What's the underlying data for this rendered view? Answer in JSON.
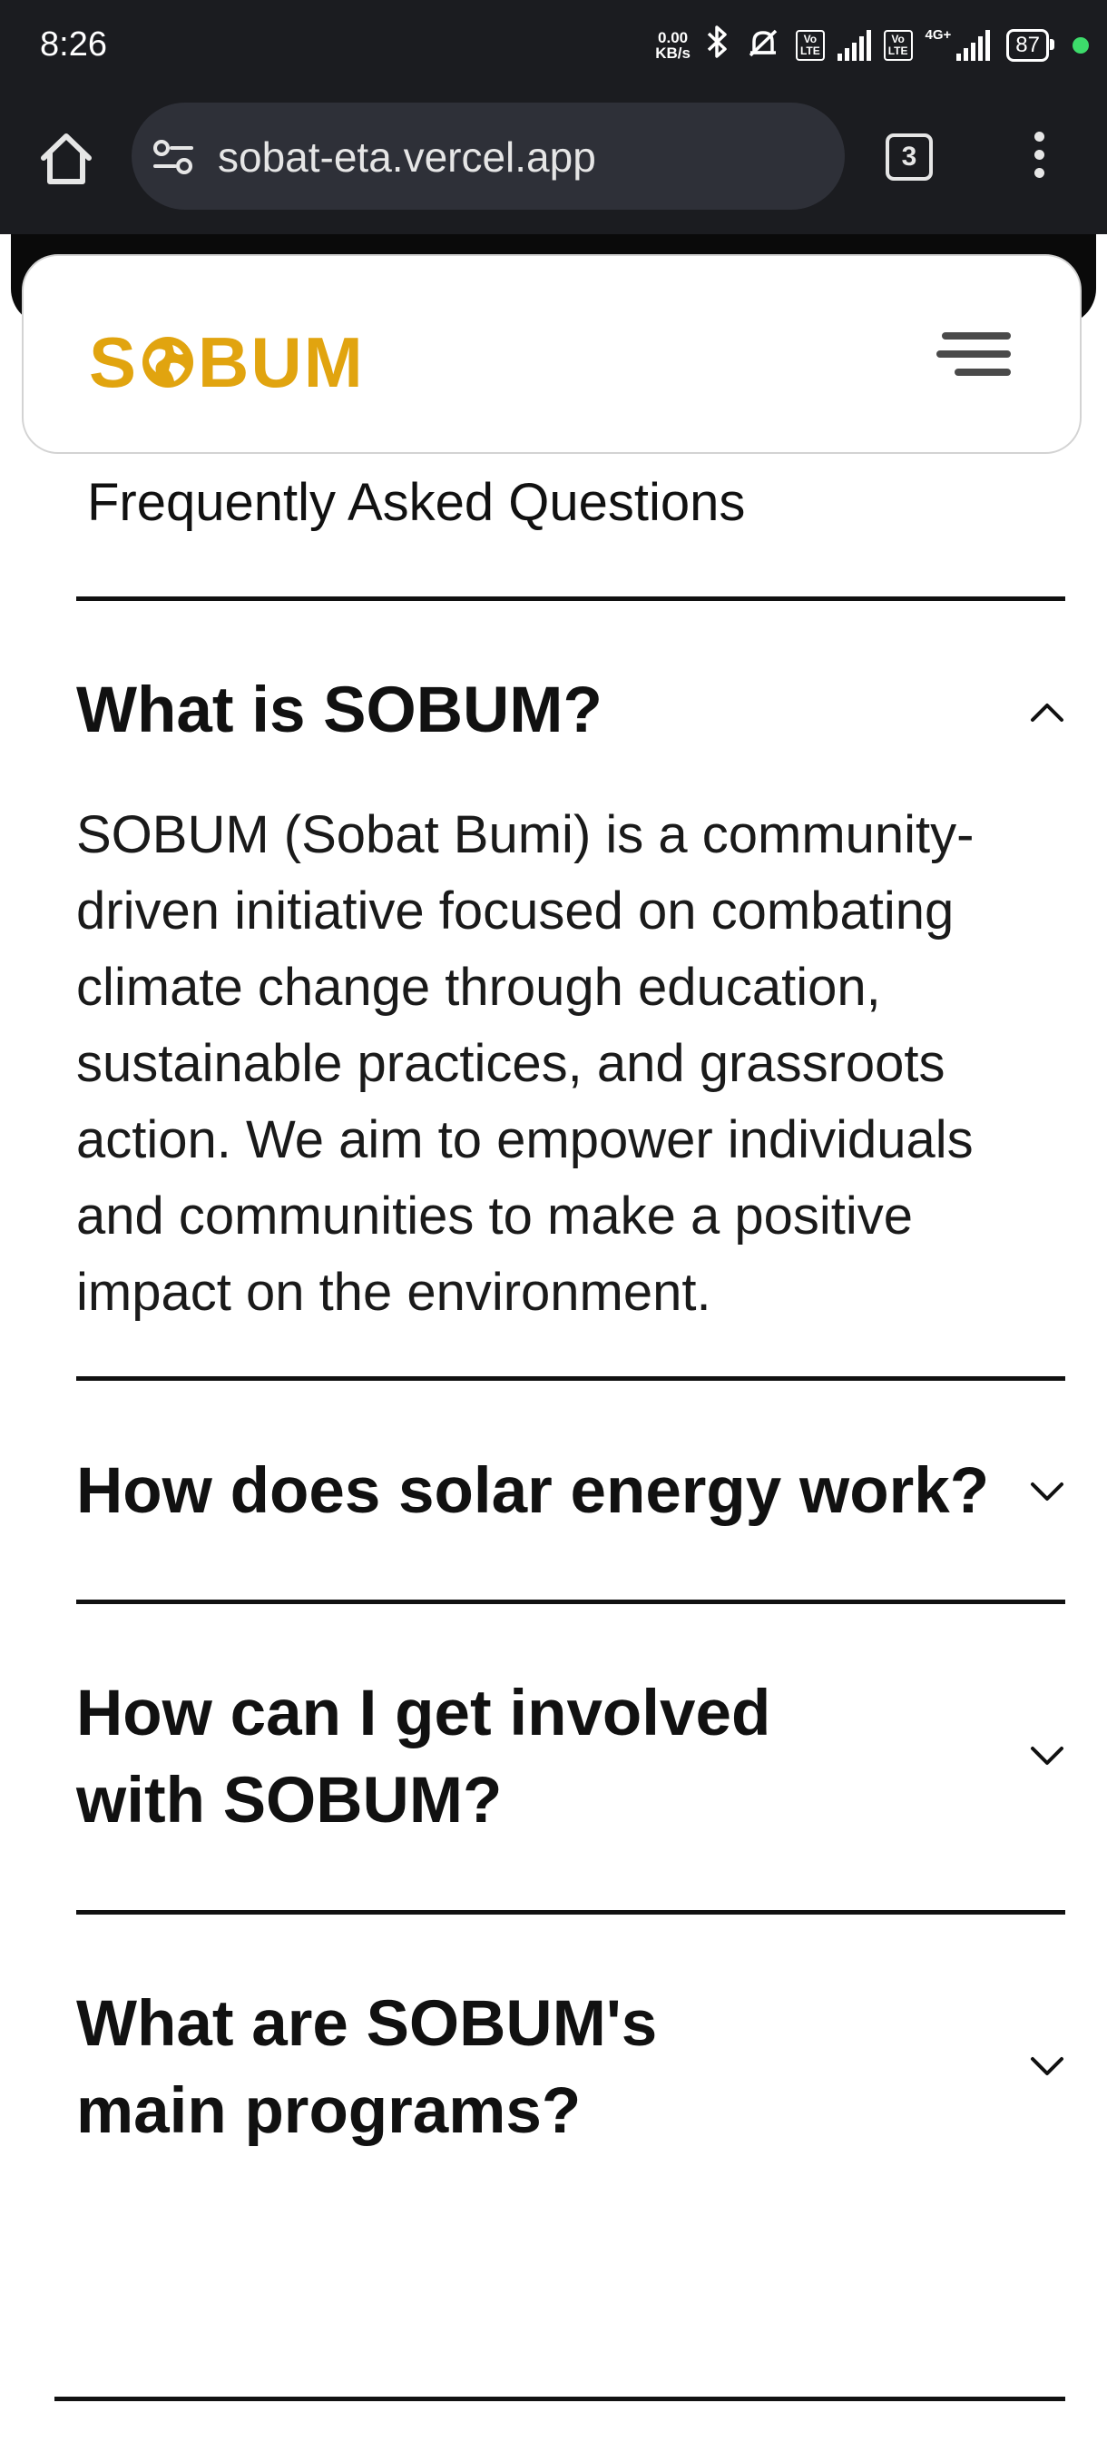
{
  "status_bar": {
    "time": "8:26",
    "net_speed_value": "0.00",
    "net_speed_unit": "KB/s",
    "network_label": "4G+",
    "battery": "87"
  },
  "browser": {
    "url": "sobat-eta.vercel.app",
    "tab_count": "3"
  },
  "site": {
    "logo_left": "S",
    "logo_right": "BUM",
    "brand_color": "#e1a40f"
  },
  "faq": {
    "heading": "Frequently Asked Questions",
    "items": [
      {
        "question": "What is SOBUM?",
        "answer": "SOBUM (Sobat Bumi) is a community-driven initiative focused on combating climate change through education, sustainable practices, and grassroots action. We aim to empower individuals and communities to make a positive impact on the environment.",
        "expanded": true
      },
      {
        "question": "How does solar energy work?",
        "expanded": false
      },
      {
        "question": "How can I get involved with SOBUM?",
        "expanded": false
      },
      {
        "question": "What are SOBUM's main programs?",
        "expanded": false
      }
    ]
  }
}
